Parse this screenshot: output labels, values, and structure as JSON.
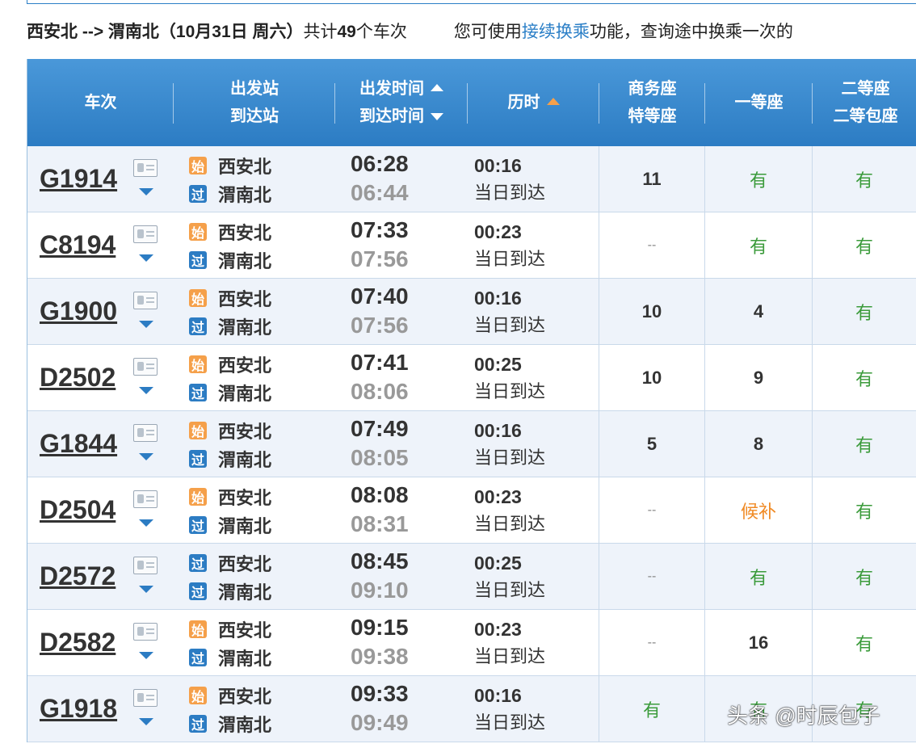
{
  "summary": {
    "route": "西安北 --> 渭南北",
    "date": "（10月31日  周六）",
    "total_prefix": "共计",
    "total_count": "49",
    "total_suffix": "个车次",
    "hint_prefix": "您可使用",
    "hint_link": "接续换乘",
    "hint_suffix": "功能，查询途中换乘一次的"
  },
  "headers": {
    "train": "车次",
    "stations_1": "出发站",
    "stations_2": "到达站",
    "time_1": "出发时间",
    "time_2": "到达时间",
    "duration": "历时",
    "business_1": "商务座",
    "business_2": "特等座",
    "first": "一等座",
    "second_1": "二等座",
    "second_2": "二等包座"
  },
  "icons": {
    "start": "始",
    "pass": "过"
  },
  "colors": {
    "header_blue": "#2c7cc3",
    "available_green": "#3b9b3b",
    "waitlist_orange": "#f08a24",
    "start_badge": "#f5a04a"
  },
  "rows": [
    {
      "train": "G1914",
      "from": "西安北",
      "from_type": "start",
      "to": "渭南北",
      "dep": "06:28",
      "arr": "06:44",
      "duration": "00:16",
      "arrival_day": "当日到达",
      "business": "11",
      "first": "有",
      "second": "有"
    },
    {
      "train": "C8194",
      "from": "西安北",
      "from_type": "start",
      "to": "渭南北",
      "dep": "07:33",
      "arr": "07:56",
      "duration": "00:23",
      "arrival_day": "当日到达",
      "business": "--",
      "first": "有",
      "second": "有"
    },
    {
      "train": "G1900",
      "from": "西安北",
      "from_type": "start",
      "to": "渭南北",
      "dep": "07:40",
      "arr": "07:56",
      "duration": "00:16",
      "arrival_day": "当日到达",
      "business": "10",
      "first": "4",
      "second": "有"
    },
    {
      "train": "D2502",
      "from": "西安北",
      "from_type": "start",
      "to": "渭南北",
      "dep": "07:41",
      "arr": "08:06",
      "duration": "00:25",
      "arrival_day": "当日到达",
      "business": "10",
      "first": "9",
      "second": "有"
    },
    {
      "train": "G1844",
      "from": "西安北",
      "from_type": "start",
      "to": "渭南北",
      "dep": "07:49",
      "arr": "08:05",
      "duration": "00:16",
      "arrival_day": "当日到达",
      "business": "5",
      "first": "8",
      "second": "有"
    },
    {
      "train": "D2504",
      "from": "西安北",
      "from_type": "start",
      "to": "渭南北",
      "dep": "08:08",
      "arr": "08:31",
      "duration": "00:23",
      "arrival_day": "当日到达",
      "business": "--",
      "first": "候补",
      "second": "有"
    },
    {
      "train": "D2572",
      "from": "西安北",
      "from_type": "pass",
      "to": "渭南北",
      "dep": "08:45",
      "arr": "09:10",
      "duration": "00:25",
      "arrival_day": "当日到达",
      "business": "--",
      "first": "有",
      "second": "有"
    },
    {
      "train": "D2582",
      "from": "西安北",
      "from_type": "start",
      "to": "渭南北",
      "dep": "09:15",
      "arr": "09:38",
      "duration": "00:23",
      "arrival_day": "当日到达",
      "business": "--",
      "first": "16",
      "second": "有"
    },
    {
      "train": "G1918",
      "from": "西安北",
      "from_type": "start",
      "to": "渭南北",
      "dep": "09:33",
      "arr": "09:49",
      "duration": "00:16",
      "arrival_day": "当日到达",
      "business": "有",
      "first": "有",
      "second": "有"
    }
  ],
  "watermark": "头条 @时辰包子"
}
